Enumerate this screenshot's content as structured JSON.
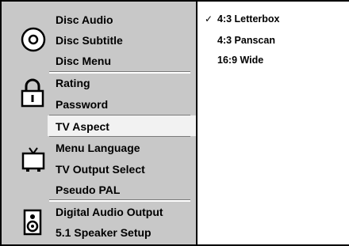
{
  "menu": {
    "disc_group": [
      "Disc Audio",
      "Disc Subtitle",
      "Disc Menu"
    ],
    "security_group": [
      "Rating",
      "Password"
    ],
    "tv_aspect": "TV Aspect",
    "display_group": [
      "Menu Language",
      "TV Output Select",
      "Pseudo PAL"
    ],
    "audio_group": [
      "Digital Audio Output",
      "5.1 Speaker Setup"
    ]
  },
  "options": {
    "check_mark": "✓",
    "items": [
      "4:3 Letterbox",
      "4:3 Panscan",
      "16:9 Wide"
    ]
  },
  "icons": [
    "disc-icon",
    "lock-icon",
    "tv-icon",
    "speaker-icon"
  ]
}
